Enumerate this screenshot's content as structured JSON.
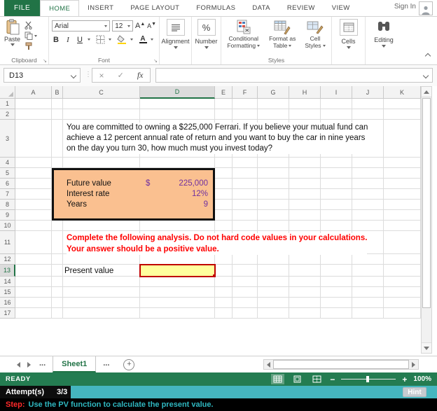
{
  "tabs": {
    "file": "FILE",
    "items": [
      {
        "label": "HOME",
        "active": true
      },
      {
        "label": "INSERT",
        "active": false
      },
      {
        "label": "PAGE LAYOUT",
        "active": false
      },
      {
        "label": "FORMULAS",
        "active": false
      },
      {
        "label": "DATA",
        "active": false
      },
      {
        "label": "REVIEW",
        "active": false
      },
      {
        "label": "VIEW",
        "active": false
      }
    ],
    "sign_in": "Sign In"
  },
  "ribbon": {
    "paste_label": "Paste",
    "clipboard_group": "Clipboard",
    "font_name": "Arial",
    "font_size": "12",
    "grow_font": "A",
    "shrink_font": "A",
    "bold": "B",
    "italic": "I",
    "underline": "U",
    "font_color_letter": "A",
    "font_group": "Font",
    "alignment_label": "Alignment",
    "number_label": "Number",
    "percent_icon": "%",
    "cond_format_line1": "Conditional",
    "cond_format_line2": "Formatting",
    "format_table_line1": "Format as",
    "format_table_line2": "Table",
    "cell_styles_line1": "Cell",
    "cell_styles_line2": "Styles",
    "styles_group": "Styles",
    "cells_label": "Cells",
    "editing_label": "Editing"
  },
  "formula_bar": {
    "name_box": "D13",
    "cancel": "×",
    "check": "✓",
    "fx": "fx",
    "value": ""
  },
  "sheet": {
    "columns": [
      "A",
      "B",
      "C",
      "D",
      "E",
      "F",
      "G",
      "H",
      "I",
      "J",
      "K"
    ],
    "selected_column": "D",
    "rows": [
      "1",
      "2",
      "3",
      "4",
      "5",
      "6",
      "7",
      "8",
      "9",
      "10",
      "11",
      "12",
      "13",
      "14",
      "15",
      "16",
      "17"
    ],
    "selected_row": "13",
    "problem_lines": [
      "You are committed to owning a $225,000 Ferrari. If you believe your mutual fund can",
      "achieve a 12 percent annual rate of return and you want to buy the car in nine years",
      "on the day you turn 30, how much must you invest today?"
    ],
    "inputs_box": {
      "rows": [
        {
          "label": "Future value",
          "prefix": "$",
          "value": "225,000"
        },
        {
          "label": "Interest rate",
          "prefix": "",
          "value": "12%"
        },
        {
          "label": "Years",
          "prefix": "",
          "value": "9"
        }
      ]
    },
    "instruction_lines": [
      "Complete the following analysis. Do not hard code values in your calculations.",
      "Your answer should be a positive value."
    ],
    "present_value_label": "Present value",
    "answer_cell": {
      "ref": "D13",
      "value": ""
    }
  },
  "tab_bar": {
    "ellipsis_left": "...",
    "sheet_name": "Sheet1",
    "ellipsis_right": "...",
    "add_sheet": "+"
  },
  "status_bar": {
    "ready": "READY",
    "zoom_minus": "−",
    "zoom_plus": "+",
    "zoom_pct": "100%"
  },
  "attempt_bar": {
    "label": "Attempt(s)",
    "value": "3/3",
    "hint": "Hint"
  },
  "step_bar": {
    "prefix": "Step:",
    "text": "Use the PV function to calculate the present value."
  },
  "icons_text": {
    "dots": "⋮",
    "launcher": "↘"
  },
  "colors": {
    "excel_green": "#217346",
    "box_fill": "#FAC090",
    "value_purple": "#7030A0",
    "answer_fill": "#FFFF9E",
    "answer_border": "#C00000",
    "instruction_red": "#FF0000",
    "teal_bar": "#45B6BF",
    "step_text_teal": "#2FB7C0"
  }
}
